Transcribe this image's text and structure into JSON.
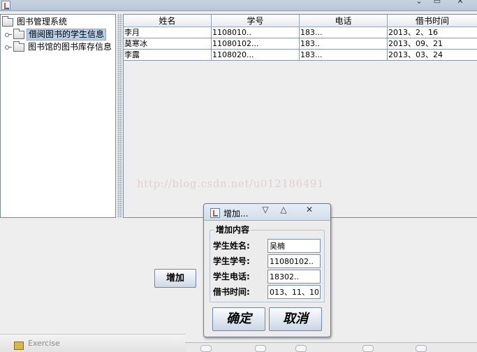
{
  "tree": {
    "root": "图书管理系统",
    "items": [
      {
        "label": "借阅图书的学生信息",
        "selected": true
      },
      {
        "label": "图书馆的图书库存信息",
        "selected": false
      }
    ]
  },
  "table": {
    "columns": [
      "姓名",
      "学号",
      "电话",
      "借书时间"
    ],
    "rows": [
      [
        "李月",
        "1108010..",
        "183...",
        "2013、2、16"
      ],
      [
        "莫寒冰",
        "11080102...",
        "183..",
        "2013、09、21"
      ],
      [
        "李露",
        "1108020...",
        "183...",
        "2013、03、24"
      ]
    ]
  },
  "watermark": "http://blog.csdn.net/u012186491",
  "add_button": "增加",
  "dialog": {
    "title": "增加...",
    "group_title": "增加内容",
    "fields": [
      {
        "label": "学生姓名:",
        "value": "吴楠"
      },
      {
        "label": "学生学号:",
        "value": "11080102.."
      },
      {
        "label": "学生电话:",
        "value": "18302.."
      },
      {
        "label": "借书时间:",
        "value": "013、11、10"
      }
    ],
    "ok_label": "确定",
    "cancel_label": "取消"
  },
  "bottom": {
    "partial_text": "Exercise"
  }
}
